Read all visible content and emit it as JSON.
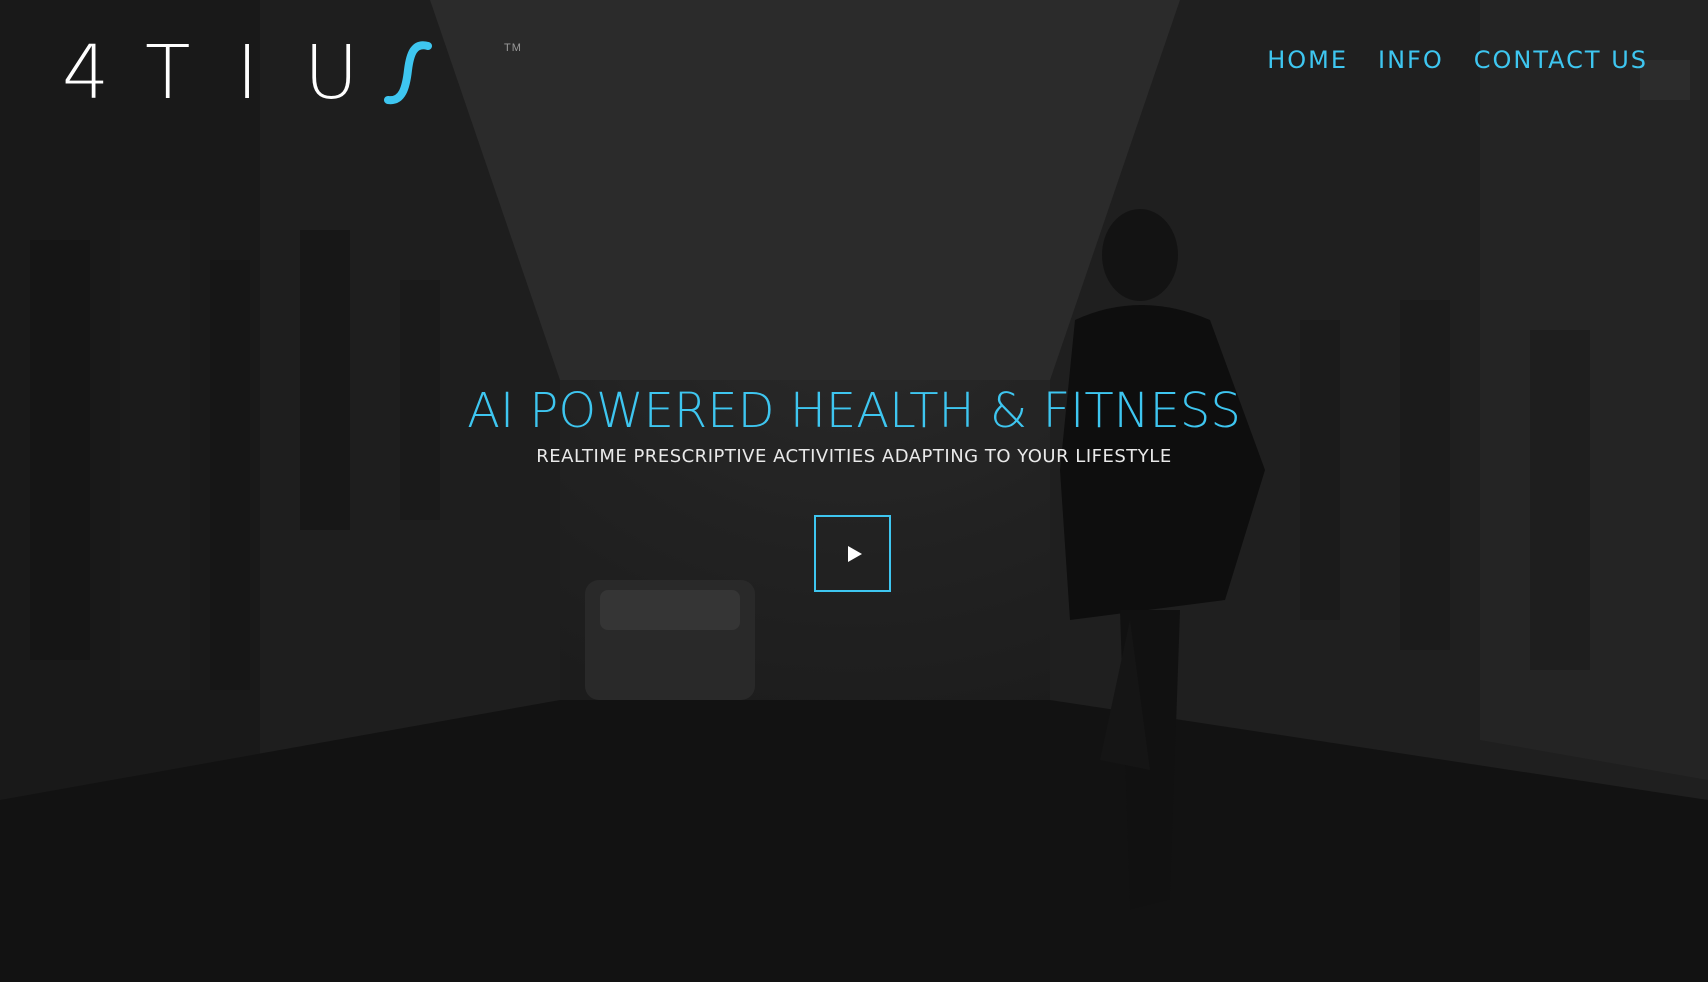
{
  "brand": {
    "letters": [
      "4",
      "T",
      "I",
      "U"
    ],
    "trademark": "TM",
    "accent_color": "#3ec6f0"
  },
  "nav": {
    "items": [
      {
        "label": "HOME"
      },
      {
        "label": "INFO"
      },
      {
        "label": "CONTACT US"
      }
    ]
  },
  "hero": {
    "title": "AI POWERED HEALTH & FITNESS",
    "subtitle": "REALTIME PRESCRIPTIVE ACTIVITIES ADAPTING TO YOUR LIFESTYLE",
    "play_icon": "play-icon"
  },
  "background": {
    "image": "dark-street-runner-photo"
  }
}
